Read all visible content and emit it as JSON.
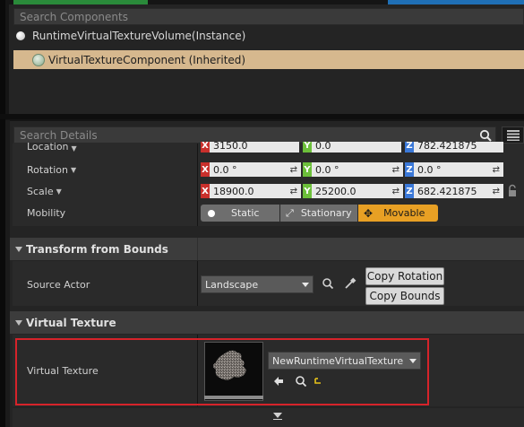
{
  "components": {
    "search_placeholder": "Search Components",
    "root_item": "RuntimeVirtualTextureVolume(Instance)",
    "child_item": "VirtualTextureComponent (Inherited)"
  },
  "details": {
    "search_placeholder": "Search Details",
    "transform": {
      "location": {
        "label": "Location",
        "x": "3150.0",
        "y": "0.0",
        "z": "782.421875"
      },
      "rotation": {
        "label": "Rotation",
        "x": "0.0 °",
        "y": "0.0 °",
        "z": "0.0 °"
      },
      "scale": {
        "label": "Scale",
        "x": "18900.0",
        "y": "25200.0",
        "z": "682.421875"
      },
      "mobility": {
        "label": "Mobility",
        "options": [
          "Static",
          "Stationary",
          "Movable"
        ],
        "selected": "Movable"
      }
    },
    "transform_from_bounds": {
      "header": "Transform from Bounds",
      "source_actor_label": "Source Actor",
      "source_actor_value": "Landscape",
      "copy_rotation": "Copy Rotation",
      "copy_bounds": "Copy Bounds"
    },
    "virtual_texture": {
      "header": "Virtual Texture",
      "label": "Virtual Texture",
      "asset_value": "NewRuntimeVirtualTexture"
    }
  },
  "axis_labels": {
    "x": "X",
    "y": "Y",
    "z": "Z"
  },
  "colors": {
    "accent_selected": "#e8a024",
    "highlight_border": "#d6232a",
    "component_selected": "#d6b88e"
  }
}
